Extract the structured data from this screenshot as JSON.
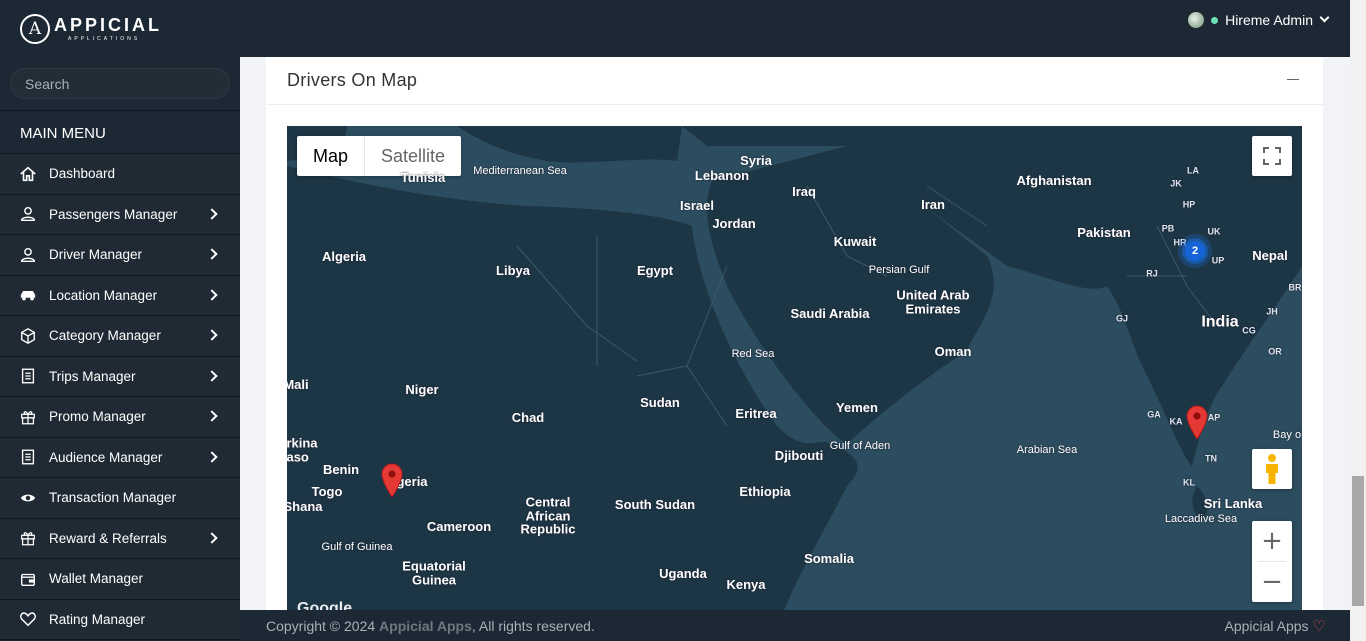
{
  "brand": {
    "logo_letter": "A",
    "name": "APPICIAL",
    "tagline": "APPLICATIONS"
  },
  "user": {
    "name": "Hireme Admin"
  },
  "sidebar": {
    "search_placeholder": "Search",
    "menu_heading": "MAIN MENU",
    "items": [
      {
        "label": "Dashboard",
        "icon": "home-icon",
        "submenu": false
      },
      {
        "label": "Passengers Manager",
        "icon": "user-icon",
        "submenu": true
      },
      {
        "label": "Driver Manager",
        "icon": "user-icon",
        "submenu": true
      },
      {
        "label": "Location Manager",
        "icon": "car-icon",
        "submenu": true
      },
      {
        "label": "Category Manager",
        "icon": "cube-icon",
        "submenu": true
      },
      {
        "label": "Trips Manager",
        "icon": "list-icon",
        "submenu": true
      },
      {
        "label": "Promo Manager",
        "icon": "gift-icon",
        "submenu": true
      },
      {
        "label": "Audience Manager",
        "icon": "list-icon",
        "submenu": true
      },
      {
        "label": "Transaction Manager",
        "icon": "eye-icon",
        "submenu": false
      },
      {
        "label": "Reward & Referrals",
        "icon": "gift-icon",
        "submenu": true
      },
      {
        "label": "Wallet Manager",
        "icon": "wallet-icon",
        "submenu": false
      },
      {
        "label": "Rating Manager",
        "icon": "heart-icon",
        "submenu": false
      }
    ]
  },
  "card": {
    "title": "Drivers On Map"
  },
  "map": {
    "type_buttons": {
      "map": "Map",
      "satellite": "Satellite"
    },
    "cluster_count": "2",
    "attribution": "Google",
    "labels": {
      "syria": "Syria",
      "lebanon": "Lebanon",
      "israel": "Israel",
      "jordan": "Jordan",
      "iraq": "Iraq",
      "iran": "Iran",
      "afghanistan": "Afghanistan",
      "pakistan": "Pakistan",
      "nepal": "Nepal",
      "india": "India",
      "kuwait": "Kuwait",
      "tunisia": "Tunisia",
      "mediterranean": "Mediterranean Sea",
      "algeria": "Algeria",
      "libya": "Libya",
      "egypt": "Egypt",
      "persian_gulf": "Persian Gulf",
      "uae": "United Arab\nEmirates",
      "saudi": "Saudi Arabia",
      "oman": "Oman",
      "red_sea": "Red Sea",
      "mali": "Mali",
      "niger": "Niger",
      "chad": "Chad",
      "sudan": "Sudan",
      "eritrea": "Eritrea",
      "yemen": "Yemen",
      "gulf_aden": "Gulf of Aden",
      "djibouti": "Djibouti",
      "arabian_sea": "Arabian Sea",
      "burkina": "rkina\naso",
      "benin": "Benin",
      "nigeria": "geria",
      "togo": "Togo",
      "ghana": "Shana",
      "car": "Central\nAfrican\nRepublic",
      "cameroon": "Cameroon",
      "south_sudan": "South Sudan",
      "ethiopia": "Ethiopia",
      "gulf_guinea": "Gulf of Guinea",
      "eq_guinea": "Equatorial\nGuinea",
      "uganda": "Uganda",
      "kenya": "Kenya",
      "somalia": "Somalia",
      "sri_lanka": "Sri Lanka",
      "laccadive": "Laccadive Sea",
      "bay": "Bay o",
      "st_la": "LA",
      "st_jk": "JK",
      "st_hp": "HP",
      "st_pb": "PB",
      "st_uk": "UK",
      "st_hr": "HR",
      "st_up": "UP",
      "st_rj": "RJ",
      "st_gj": "GJ",
      "st_br": "BR",
      "st_jh": "JH",
      "st_cg": "CG",
      "st_or": "OR",
      "st_ga": "GA",
      "st_ka": "KA",
      "st_ap": "AP",
      "st_tn": "TN",
      "st_kl": "KL"
    }
  },
  "footer": {
    "copyright_prefix": "Copyright © 2024 ",
    "copyright_brand": "Appicial Apps",
    "copyright_suffix": ", All rights reserved.",
    "right_text": "Appicial Apps"
  },
  "colors": {
    "topbar": "#1c2833",
    "map_water": "#2c4d5f",
    "map_land": "#1d3645",
    "pin": "#e53935",
    "cluster": "#1a73e8"
  }
}
